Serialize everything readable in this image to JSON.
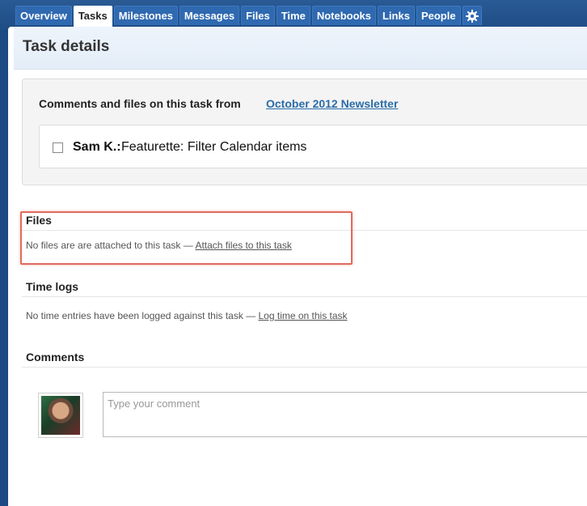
{
  "nav": {
    "tabs": [
      {
        "label": "Overview"
      },
      {
        "label": "Tasks"
      },
      {
        "label": "Milestones"
      },
      {
        "label": "Messages"
      },
      {
        "label": "Files"
      },
      {
        "label": "Time"
      },
      {
        "label": "Notebooks"
      },
      {
        "label": "Links"
      },
      {
        "label": "People"
      }
    ],
    "active_tab": "Tasks",
    "settings_icon": "gear-icon"
  },
  "header": {
    "title": "Task details"
  },
  "comments_box": {
    "title": "Comments and files on this task from",
    "project_link": "October 2012 Newsletter",
    "task": {
      "checked": false,
      "assignee": "Sam K.:",
      "name": "Featurette: Filter Calendar items"
    }
  },
  "files": {
    "title": "Files",
    "text": "No files are are attached to this task — ",
    "link": "Attach files to this task",
    "highlight_color": "#e06b5e"
  },
  "time_logs": {
    "title": "Time logs",
    "text": "No time entries have been logged against this task — ",
    "link": "Log time on this task"
  },
  "comments": {
    "title": "Comments",
    "input_placeholder": "Type your comment",
    "input_value": ""
  },
  "colors": {
    "brand_blue": "#1c4a82",
    "link_blue": "#2a6ca8",
    "tab_blue": "#2f69b0"
  }
}
